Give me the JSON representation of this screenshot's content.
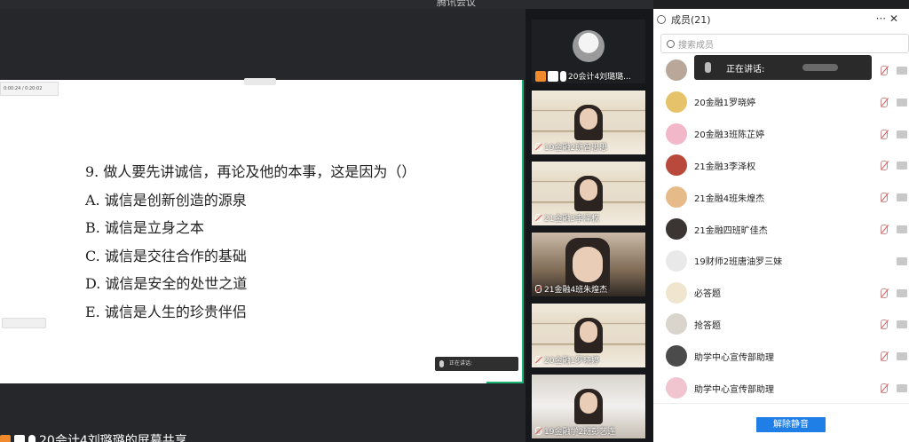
{
  "window": {
    "title": "腾讯会议"
  },
  "stage": {
    "mini_player_time": "0:00:24 / 0:20:02",
    "question": {
      "stem": "9. 做人要先讲诚信，再论及他的本事，这是因为（）",
      "options": [
        "A. 诚信是创新创造的源泉",
        "B. 诚信是立身之本",
        "C. 诚信是交往合作的基础",
        "D. 诚信是安全的处世之道",
        "E. 诚信是人生的珍贵伴侣"
      ]
    },
    "speaking_label": "正在讲话:",
    "share_label": "20会计4刘璐璐的屏幕共享"
  },
  "videos": [
    {
      "name": "20会计4刘璐璐...",
      "style": "avatar"
    },
    {
      "name": "19金融2班曾思思",
      "style": "shelf"
    },
    {
      "name": "21金融3李泽权",
      "style": "shelf"
    },
    {
      "name": "21金融4班朱煌杰",
      "style": "closeup"
    },
    {
      "name": "20金融1罗晓婷",
      "style": "shelf"
    },
    {
      "name": "19金融学2班彭艺连",
      "style": "room"
    }
  ],
  "panel": {
    "title": "成员(21)",
    "more_label": "···",
    "close_label": "✕",
    "search_placeholder": "搜索成员",
    "tooltip": "正在讲话:",
    "members": [
      {
        "name": "",
        "color": "#b9a89a",
        "muted": true
      },
      {
        "name": "20金融1罗晓婷",
        "color": "#e6c36a",
        "muted": true
      },
      {
        "name": "20金融3班陈芷婷",
        "color": "#f2b7c9",
        "muted": true
      },
      {
        "name": "21金融3李泽权",
        "color": "#b94a3b",
        "muted": true
      },
      {
        "name": "21金融4班朱煌杰",
        "color": "#e7ba8a",
        "muted": true
      },
      {
        "name": "21金融四班旷佳杰",
        "color": "#3a3432",
        "muted": true
      },
      {
        "name": "19财师2班唐油罗三妹",
        "color": "#e9e9e9",
        "muted": false
      },
      {
        "name": "必答题",
        "color": "#f0e6cf",
        "muted": true
      },
      {
        "name": "抢答题",
        "color": "#d9d4cc",
        "muted": true
      },
      {
        "name": "助学中心宣传部助理",
        "color": "#4b4b4b",
        "muted": true
      },
      {
        "name": "助学中心宣传部助理",
        "color": "#f1c5cf",
        "muted": true
      }
    ],
    "unmute_all": "解除静音"
  },
  "colors": {
    "accent_green": "#18b472",
    "primary_blue": "#1f7fe6"
  }
}
